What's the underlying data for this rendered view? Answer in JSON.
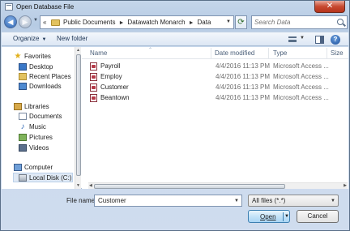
{
  "window": {
    "title": "Open Database File",
    "close_symbol": "✕"
  },
  "address": {
    "crumbs": [
      "Public Documents",
      "Datawatch Monarch",
      "Data"
    ],
    "separator": "►"
  },
  "search": {
    "placeholder": "Search Data"
  },
  "toolbar": {
    "organize_label": "Organize",
    "new_folder_label": "New folder",
    "help_symbol": "?"
  },
  "nav": {
    "favorites_label": "Favorites",
    "favorites": [
      "Desktop",
      "Recent Places",
      "Downloads"
    ],
    "libraries_label": "Libraries",
    "libraries": [
      "Documents",
      "Music",
      "Pictures",
      "Videos"
    ],
    "computer_label": "Computer",
    "computer_items": [
      "Local Disk (C:)"
    ]
  },
  "columns": {
    "name": "Name",
    "date": "Date modified",
    "type": "Type",
    "size": "Size"
  },
  "files": [
    {
      "name": "Payroll",
      "date": "4/4/2016 11:13 PM",
      "type": "Microsoft Access ..."
    },
    {
      "name": "Employ",
      "date": "4/4/2016 11:13 PM",
      "type": "Microsoft Access ..."
    },
    {
      "name": "Customer",
      "date": "4/4/2016 11:13 PM",
      "type": "Microsoft Access ..."
    },
    {
      "name": "Beantown",
      "date": "4/4/2016 11:13 PM",
      "type": "Microsoft Access ..."
    }
  ],
  "footer": {
    "file_name_label": "File name:",
    "file_name_value": "Customer",
    "file_type_value": "All files (*.*)",
    "open_label": "Open",
    "cancel_label": "Cancel"
  },
  "colors": {
    "accent": "#3c7fb1",
    "frame": "#b6cbe4",
    "close": "#c7492f"
  }
}
